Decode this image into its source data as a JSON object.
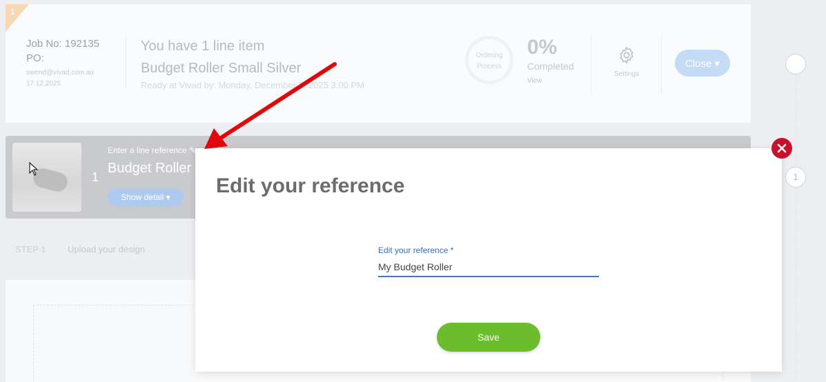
{
  "job": {
    "badge": "1",
    "job_no": "Job No: 192135",
    "po": "PO:",
    "email": "swend@vivad.com.au",
    "date": "17.12.2025",
    "line_count": "You have 1 line item",
    "product": "Budget Roller Small Silver",
    "ready": "Ready at Vivad by:  Monday, December 2, 2025 3:00 PM",
    "process_label": "Ordering Process",
    "progress_pct": "0%",
    "progress_value": 0,
    "completed": "Completed",
    "view": "View",
    "settings": "Settings",
    "close": "Close"
  },
  "timeline": {
    "node_2": "1"
  },
  "line_item": {
    "ref_label": "Enter a line reference",
    "number": "1",
    "title": "Budget Roller",
    "show_detail": "Show detail"
  },
  "step": {
    "label": "STEP 1",
    "text": "Upload your design"
  },
  "modal": {
    "title": "Edit your reference",
    "field_label": "Edit your reference *",
    "field_value": "My Budget Roller",
    "save": "Save"
  },
  "colors": {
    "accent": "#3d79c8",
    "save_green": "#6bbd2c",
    "close_red": "#c8102e",
    "arrow_red": "#e0080b"
  }
}
